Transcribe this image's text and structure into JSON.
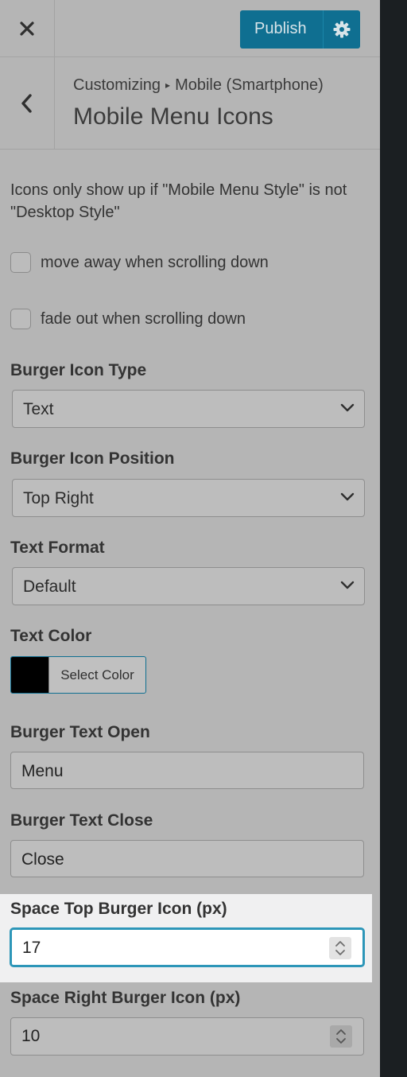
{
  "header": {
    "close_icon": "close-icon",
    "publish_label": "Publish",
    "settings_icon": "gear-icon"
  },
  "section": {
    "breadcrumb_parent": "Customizing",
    "breadcrumb_separator": "▸",
    "breadcrumb_current": "Mobile (Smartphone)",
    "title": "Mobile Menu Icons"
  },
  "description": "Icons only show up if \"Mobile Menu Style\" is not \"Desktop Style\"",
  "checkboxes": [
    {
      "label": "move away when scrolling down",
      "checked": false
    },
    {
      "label": "fade out when scrolling down",
      "checked": false
    }
  ],
  "fields": {
    "burger_icon_type": {
      "label": "Burger Icon Type",
      "value": "Text"
    },
    "burger_icon_position": {
      "label": "Burger Icon Position",
      "value": "Top Right"
    },
    "text_format": {
      "label": "Text Format",
      "value": "Default"
    },
    "text_color": {
      "label": "Text Color",
      "button_label": "Select Color",
      "color": "#000000"
    },
    "burger_text_open": {
      "label": "Burger Text Open",
      "value": "Menu"
    },
    "burger_text_close": {
      "label": "Burger Text Close",
      "value": "Close"
    },
    "space_top": {
      "label": "Space Top Burger Icon (px)",
      "value": "17"
    },
    "space_right": {
      "label": "Space Right Burger Icon (px)",
      "value": "10"
    }
  },
  "colors": {
    "accent": "#0f6f91",
    "focus": "#2d96b8",
    "overlay_bg": "#b5b5b5"
  }
}
